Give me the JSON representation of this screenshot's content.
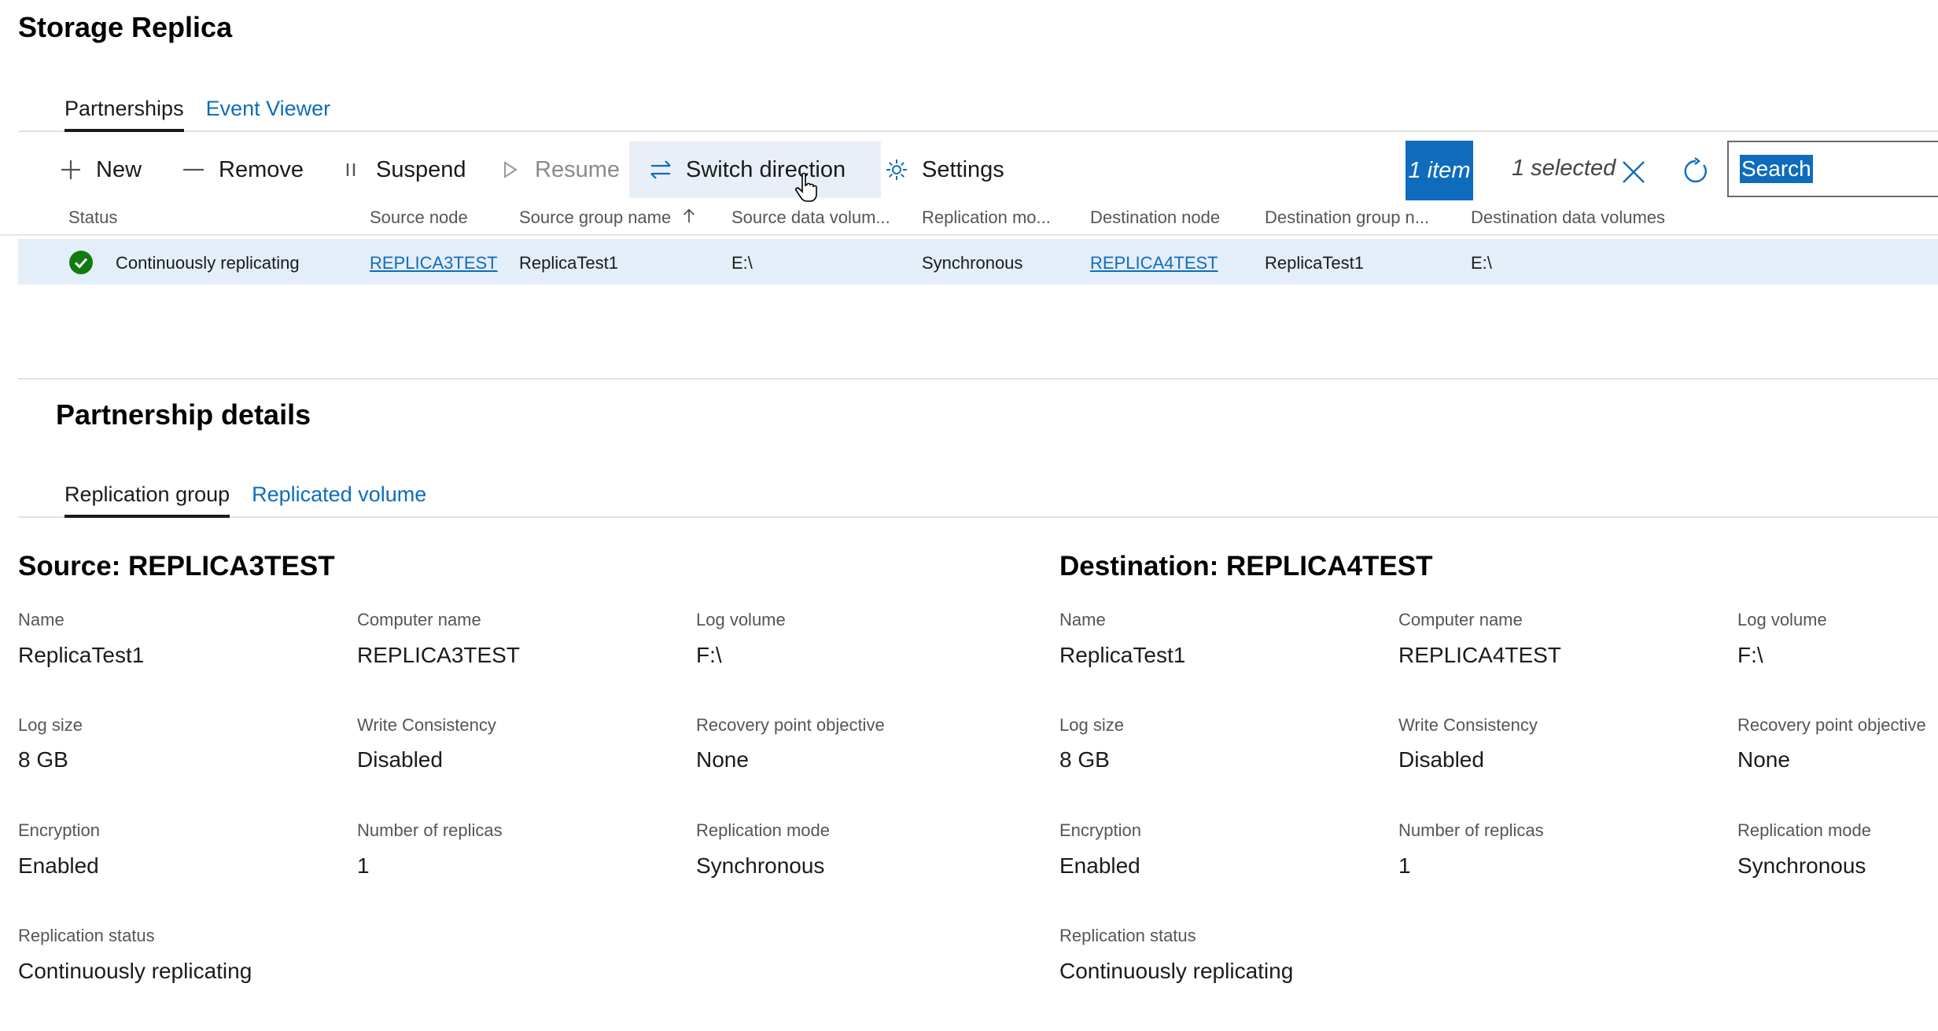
{
  "page_title": "Storage Replica",
  "top_tabs": [
    {
      "label": "Partnerships",
      "active": true
    },
    {
      "label": "Event Viewer",
      "active": false
    }
  ],
  "toolbar": {
    "new_label": "New",
    "remove_label": "Remove",
    "suspend_label": "Suspend",
    "resume_label": "Resume",
    "switch_label": "Switch direction",
    "settings_label": "Settings",
    "item_count": "1 item",
    "selected_label": "1 selected",
    "search_placeholder": "Search"
  },
  "grid": {
    "columns": [
      "Status",
      "Source node",
      "Source group name",
      "Source data volum...",
      "Replication mo...",
      "Destination node",
      "Destination group n...",
      "Destination data volumes"
    ],
    "sort_column": "Source group name",
    "rows": [
      {
        "status": "Continuously replicating",
        "source_node": "REPLICA3TEST",
        "source_group": "ReplicaTest1",
        "source_volume": "E:\\",
        "replication_mode": "Synchronous",
        "destination_node": "REPLICA4TEST",
        "destination_group": "ReplicaTest1",
        "destination_volume": "E:\\"
      }
    ]
  },
  "details": {
    "title": "Partnership details",
    "tabs": [
      {
        "label": "Replication group",
        "active": true
      },
      {
        "label": "Replicated volume",
        "active": false
      }
    ],
    "source": {
      "title": "Source: REPLICA3TEST",
      "fields": [
        {
          "label": "Name",
          "value": "ReplicaTest1"
        },
        {
          "label": "Computer name",
          "value": "REPLICA3TEST"
        },
        {
          "label": "Log volume",
          "value": "F:\\"
        },
        {
          "label": "Log size",
          "value": "8 GB"
        },
        {
          "label": "Write Consistency",
          "value": "Disabled"
        },
        {
          "label": "Recovery point objective",
          "value": "None"
        },
        {
          "label": "Encryption",
          "value": "Enabled"
        },
        {
          "label": "Number of replicas",
          "value": "1"
        },
        {
          "label": "Replication mode",
          "value": "Synchronous"
        },
        {
          "label": "Replication status",
          "value": "Continuously replicating"
        }
      ]
    },
    "destination": {
      "title": "Destination: REPLICA4TEST",
      "fields": [
        {
          "label": "Name",
          "value": "ReplicaTest1"
        },
        {
          "label": "Computer name",
          "value": "REPLICA4TEST"
        },
        {
          "label": "Log volume",
          "value": "F:\\"
        },
        {
          "label": "Log size",
          "value": "8 GB"
        },
        {
          "label": "Write Consistency",
          "value": "Disabled"
        },
        {
          "label": "Recovery point objective",
          "value": "None"
        },
        {
          "label": "Encryption",
          "value": "Enabled"
        },
        {
          "label": "Number of replicas",
          "value": "1"
        },
        {
          "label": "Replication mode",
          "value": "Synchronous"
        },
        {
          "label": "Replication status",
          "value": "Continuously replicating"
        }
      ]
    }
  },
  "colors": {
    "accent": "#0f6cbd",
    "row_selected": "#e4eef8",
    "status_ok": "#107c10"
  }
}
